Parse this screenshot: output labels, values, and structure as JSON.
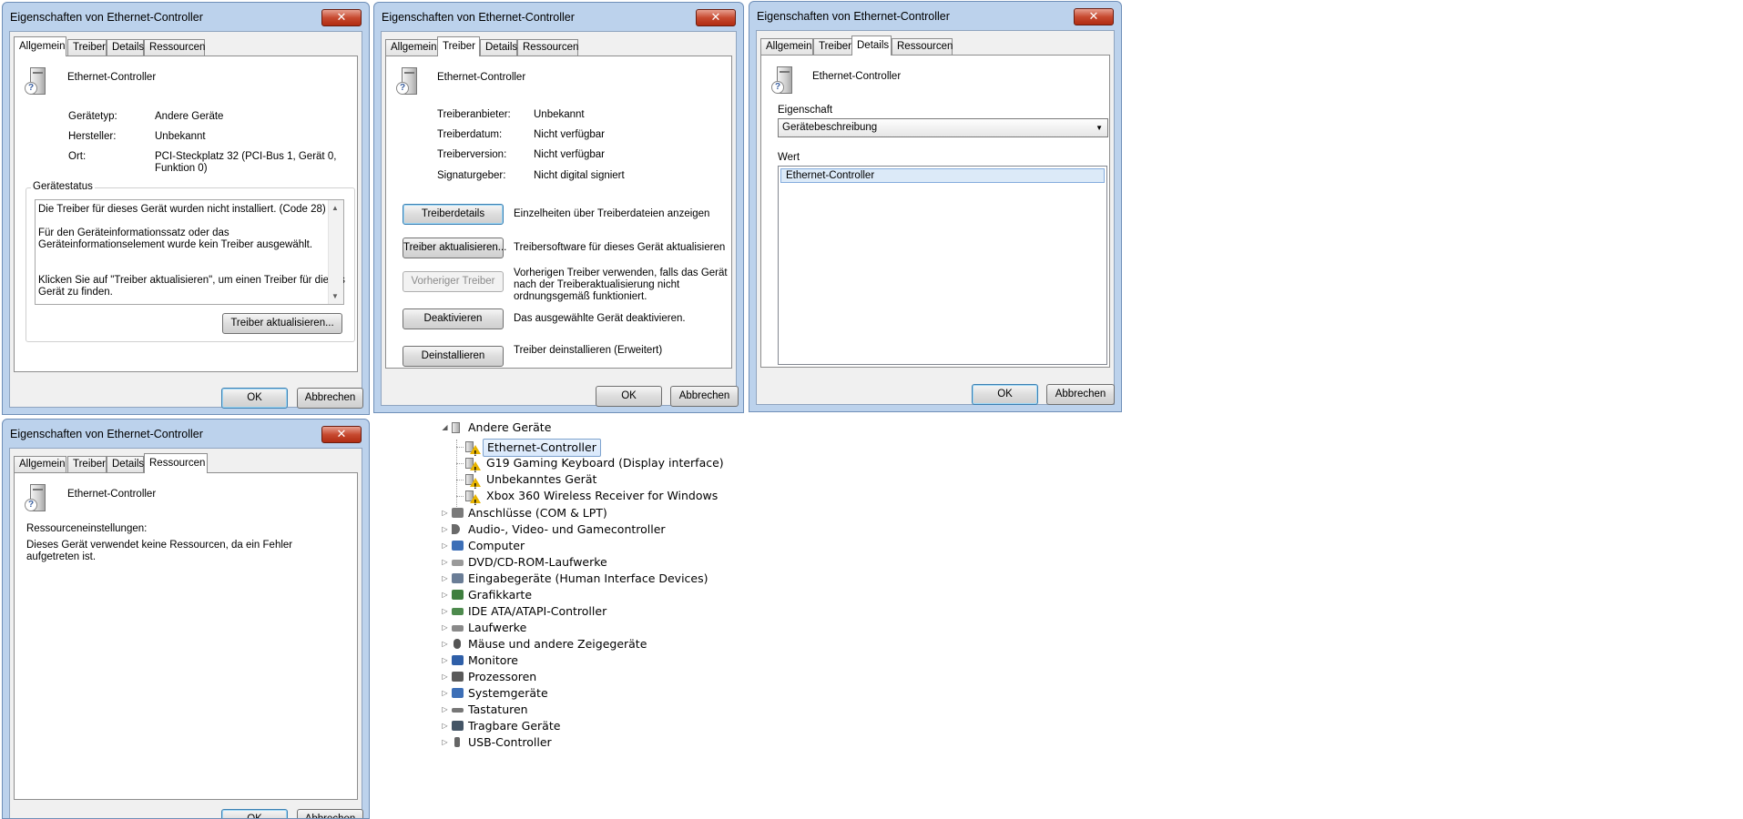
{
  "windows": {
    "title": "Eigenschaften von Ethernet-Controller",
    "close_glyph": "✕",
    "tabs": [
      "Allgemein",
      "Treiber",
      "Details",
      "Ressourcen"
    ],
    "ok": "OK",
    "cancel": "Abbrechen",
    "device_name": "Ethernet-Controller"
  },
  "allgemein": {
    "rows": [
      {
        "label": "Gerätetyp:",
        "value": "Andere Geräte"
      },
      {
        "label": "Hersteller:",
        "value": "Unbekannt"
      },
      {
        "label": "Ort:",
        "value": "PCI-Steckplatz 32 (PCI-Bus 1, Gerät 0,",
        "value2": "Funktion 0)"
      }
    ],
    "status_group": "Gerätestatus",
    "status_lines": [
      "Die Treiber für dieses Gerät wurden nicht installiert. (Code 28)",
      "Für den Geräteinformationssatz oder das",
      "Geräteinformationselement wurde kein Treiber ausgewählt.",
      "Klicken Sie auf \"Treiber aktualisieren\", um einen Treiber für dieses",
      "Gerät zu finden."
    ],
    "update_button": "Treiber aktualisieren..."
  },
  "treiber": {
    "rows": [
      {
        "label": "Treiberanbieter:",
        "value": "Unbekannt"
      },
      {
        "label": "Treiberdatum:",
        "value": "Nicht verfügbar"
      },
      {
        "label": "Treiberversion:",
        "value": "Nicht verfügbar"
      },
      {
        "label": "Signaturgeber:",
        "value": "Nicht digital signiert"
      }
    ],
    "actions": [
      {
        "button": "Treiberdetails",
        "desc": [
          "Einzelheiten über Treiberdateien anzeigen"
        ]
      },
      {
        "button": "Treiber aktualisieren...",
        "desc": [
          "Treibersoftware für dieses Gerät aktualisieren"
        ]
      },
      {
        "button": "Vorheriger Treiber",
        "desc": [
          "Vorherigen Treiber verwenden, falls das Gerät",
          "nach der Treiberaktualisierung nicht",
          "ordnungsgemäß funktioniert."
        ]
      },
      {
        "button": "Deaktivieren",
        "desc": [
          "Das ausgewählte Gerät deaktivieren."
        ]
      },
      {
        "button": "Deinstallieren",
        "desc": [
          "Treiber deinstallieren (Erweitert)"
        ]
      }
    ]
  },
  "details": {
    "property_label": "Eigenschaft",
    "property_value": "Gerätebeschreibung",
    "value_label": "Wert",
    "value_item": "Ethernet-Controller"
  },
  "ressourcen": {
    "settings_label": "Ressourceneinstellungen:",
    "message": [
      "Dieses Gerät verwendet keine Ressourcen, da ein Fehler",
      "aufgetreten ist."
    ]
  },
  "tree": {
    "root": "Andere Geräte",
    "children": [
      "Ethernet-Controller",
      "G19 Gaming Keyboard (Display interface)",
      "Unbekanntes Gerät",
      "Xbox 360 Wireless Receiver for Windows"
    ],
    "categories": [
      {
        "label": "Anschlüsse (COM & LPT)",
        "icon": "port-icon",
        "color": "#7a7a7a"
      },
      {
        "label": "Audio-, Video- und Gamecontroller",
        "icon": "speaker-icon",
        "color": "#6a6a6a"
      },
      {
        "label": "Computer",
        "icon": "computer-icon",
        "color": "#3d6fb7"
      },
      {
        "label": "DVD/CD-ROM-Laufwerke",
        "icon": "dvd-drive-icon",
        "color": "#9a9a9a"
      },
      {
        "label": "Eingabegeräte (Human Interface Devices)",
        "icon": "hid-icon",
        "color": "#6a7d96"
      },
      {
        "label": "Grafikkarte",
        "icon": "graphics-card-icon",
        "color": "#3f7f3f"
      },
      {
        "label": "IDE ATA/ATAPI-Controller",
        "icon": "ide-controller-icon",
        "color": "#4d8a4d"
      },
      {
        "label": "Laufwerke",
        "icon": "disk-drive-icon",
        "color": "#8a8a8a"
      },
      {
        "label": "Mäuse und andere Zeigegeräte",
        "icon": "mouse-icon",
        "color": "#555555"
      },
      {
        "label": "Monitore",
        "icon": "monitor-icon",
        "color": "#2f5fa8"
      },
      {
        "label": "Prozessoren",
        "icon": "processor-icon",
        "color": "#5a5a5a"
      },
      {
        "label": "Systemgeräte",
        "icon": "system-devices-icon",
        "color": "#3d6fb7"
      },
      {
        "label": "Tastaturen",
        "icon": "keyboard-icon",
        "color": "#777777"
      },
      {
        "label": "Tragbare Geräte",
        "icon": "portable-device-icon",
        "color": "#445566"
      },
      {
        "label": "USB-Controller",
        "icon": "usb-icon",
        "color": "#666666"
      }
    ],
    "expand_glyph": "▷",
    "collapse_glyph": "◢"
  }
}
